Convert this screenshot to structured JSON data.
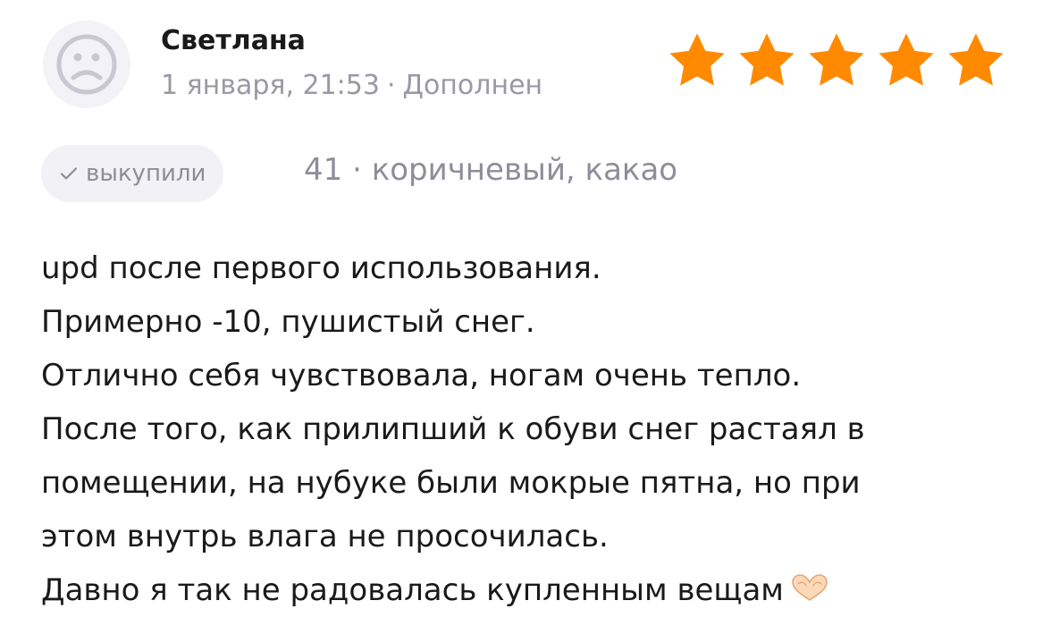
{
  "review": {
    "author": {
      "name": "Светлана",
      "avatar_icon": "sad-face-icon"
    },
    "meta": {
      "date": "1 января, 21:53",
      "separator": "·",
      "status": "Дополнен"
    },
    "rating": {
      "value": 5,
      "max": 5,
      "color": "#ff8a00"
    },
    "purchase_badge": {
      "check_icon": "check-icon",
      "label": "выкупили"
    },
    "variant": {
      "size": "41",
      "separator": "·",
      "color_name": "коричневый, какао"
    },
    "text_lines": [
      "upd после первого использования.",
      "Примерно -10, пушистый снег.",
      "Отлично себя чувствовала, ногам очень тепло.",
      "После того, как прилипший к обуви снег растаял в",
      "помещении, на нубуке были мокрые пятна, но при",
      "этом внутрь влага не просочилась.",
      "Давно я так не радовалась купленным вещам"
    ],
    "trailing_emoji_icon": "heart-hands-icon"
  },
  "colors": {
    "text_primary": "#1a1a1a",
    "text_secondary": "#9a98a4",
    "badge_bg": "#f2f1f5",
    "avatar_bg": "#f3f2f6",
    "star": "#ff8a00"
  }
}
